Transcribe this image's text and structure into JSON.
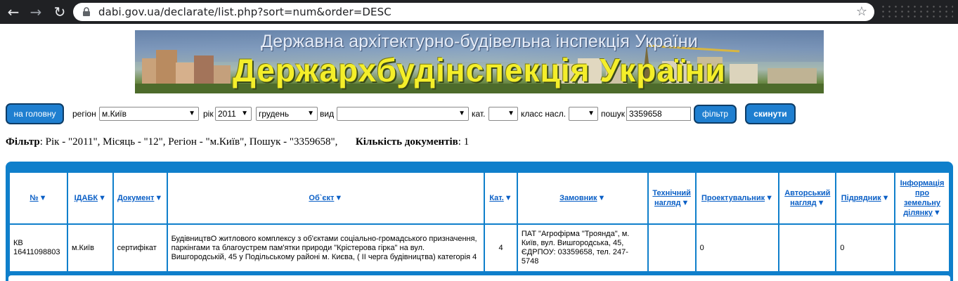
{
  "browser": {
    "url": "dabi.gov.ua/declarate/list.php?sort=num&order=DESC"
  },
  "banner": {
    "subtitle": "Державна архітектурно-будівельна інспекція України",
    "title": "Держархбудінспекція України"
  },
  "filters": {
    "home_button": "на головну",
    "region_label": "регіон",
    "region_value": "м.Київ",
    "year_label": "рік",
    "year_value": "2011",
    "month_value": "грудень",
    "type_label": "вид",
    "type_value": "",
    "cat_label": "кат.",
    "cat_value": "",
    "class_label": "класс насл.",
    "class_value": "",
    "search_label": "пошук",
    "search_value": "3359658",
    "filter_button": "фільтр",
    "reset_button": "скинути"
  },
  "summary": {
    "filter_label": "Фільтр",
    "filter_text": ": Рік - \"2011\", Місяць - \"12\", Регіон - \"м.Київ\", Пошук - \"3359658\",",
    "count_label": "Кількість документів",
    "count_value": ": 1"
  },
  "table": {
    "headers": [
      "№",
      "ІДАБК",
      "Документ",
      "Об`єкт",
      "Кат.",
      "Замовник",
      "Технічний нагляд",
      "Проектувальник",
      "Авторський нагляд",
      "Підрядник",
      "Інформація про земельну ділянку"
    ],
    "rows": [
      {
        "num": "КВ 16411098803",
        "idabk": "м.Київ",
        "document": "сертифікат",
        "object": "БудівництвО житлового комплексу з об'єктами соціально-громадського призначення, паркінгами та благоустрем пам'ятки природи \"Крістерова гірка\" на вул. Вишгородській, 45 у Подільському районі м. Києва, ( ІІ черга будівництва) категорія 4",
        "cat": "4",
        "customer": "ПАТ \"Агрофірма \"Троянда\", м. Київ, вул. Вишгородська, 45, ЄДРПОУ: 03359658, тел. 247-5748",
        "tech_supervision": "",
        "designer": "0",
        "author_supervision": "",
        "contractor": "0",
        "land_info": ""
      }
    ]
  },
  "colors": {
    "accent": "#1f7fd0",
    "table_frame": "#0f7fcb",
    "banner_title": "#f4ee2a",
    "link": "#0a5fc6"
  }
}
